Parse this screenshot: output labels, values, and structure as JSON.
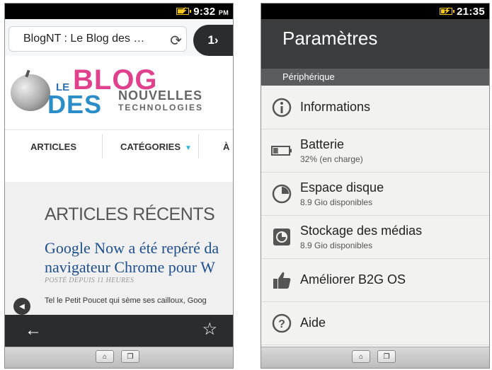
{
  "left": {
    "status": {
      "time": "9:32",
      "ampm": "PM"
    },
    "tab": {
      "url_text": "BlogNT : Le Blog des  …",
      "tab_count": "1›"
    },
    "logo": {
      "le": "LE",
      "blog": "BLOG",
      "des": "DES",
      "nouvelles": "NOUVELLES",
      "technologies": "TECHNOLOGIES"
    },
    "nav": {
      "articles": "ARTICLES",
      "categories": "CATÉGORIES",
      "third": "À"
    },
    "content": {
      "section_title": "ARTICLES RÉCENTS",
      "article_title_line1": "Google Now a été repéré da",
      "article_title_line2": "navigateur Chrome pour W",
      "meta": "POSTÉ DEPUIS 11 HEURES",
      "excerpt": "Tel le Petit Poucet qui sème ses cailloux, Goog"
    }
  },
  "right": {
    "status": {
      "time": "21:35"
    },
    "header": {
      "title": "Paramètres"
    },
    "section": "Périphérique",
    "items": [
      {
        "label": "Informations",
        "sub": ""
      },
      {
        "label": "Batterie",
        "sub": "32% (en charge)"
      },
      {
        "label": "Espace disque",
        "sub": "8.9 Gio disponibles"
      },
      {
        "label": "Stockage des médias",
        "sub": "8.9 Gio disponibles"
      },
      {
        "label": "Améliorer B2G OS",
        "sub": ""
      },
      {
        "label": "Aide",
        "sub": ""
      }
    ],
    "battery_level": 0.32
  },
  "colors": {
    "accent_pink": "#e0418c",
    "accent_blue": "#2b8ec9",
    "link_blue": "#1e4f8c",
    "battery_yellow": "#f5c518"
  }
}
